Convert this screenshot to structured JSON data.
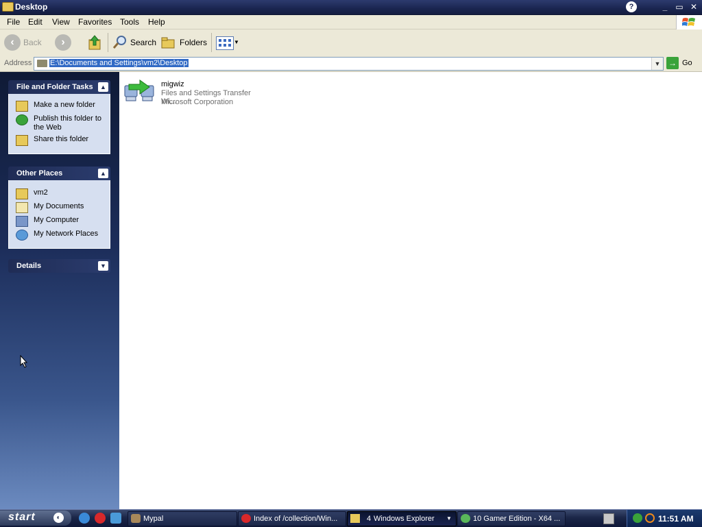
{
  "window": {
    "title": "Desktop",
    "controls": [
      "_",
      "▭",
      "✕"
    ]
  },
  "menu": [
    "File",
    "Edit",
    "View",
    "Favorites",
    "Tools",
    "Help"
  ],
  "toolbar": {
    "back_label": "Back",
    "search_label": "Search",
    "folders_label": "Folders"
  },
  "address": {
    "label": "Address",
    "value": "E:\\Documents and Settings\\vm2\\Desktop",
    "go_label": "Go"
  },
  "task_panels": {
    "file_folder_tasks": {
      "title": "File and Folder Tasks",
      "items": [
        "Make a new folder",
        "Publish this folder to the Web",
        "Share this folder"
      ]
    },
    "other_places": {
      "title": "Other Places",
      "items": [
        "vm2",
        "My Documents",
        "My Computer",
        "My Network Places"
      ]
    },
    "details": {
      "title": "Details"
    }
  },
  "files": [
    {
      "name": "migwiz",
      "description": "Files and Settings Transfer Wi...",
      "company": "Microsoft Corporation"
    }
  ],
  "taskbar": {
    "start_label": "start",
    "tasks": [
      {
        "label": "Mypal"
      },
      {
        "label": "Index of /collection/Win..."
      },
      {
        "label": "Windows Explorer",
        "count": "4"
      },
      {
        "label": "10 Gamer Edition - X64 ..."
      }
    ],
    "clock": "11:51 AM"
  },
  "colors": {
    "title_bar": "#1a2550",
    "selection": "#316ac5",
    "task_panel_bg": "#d6dff0",
    "go_green": "#3aa33a"
  }
}
